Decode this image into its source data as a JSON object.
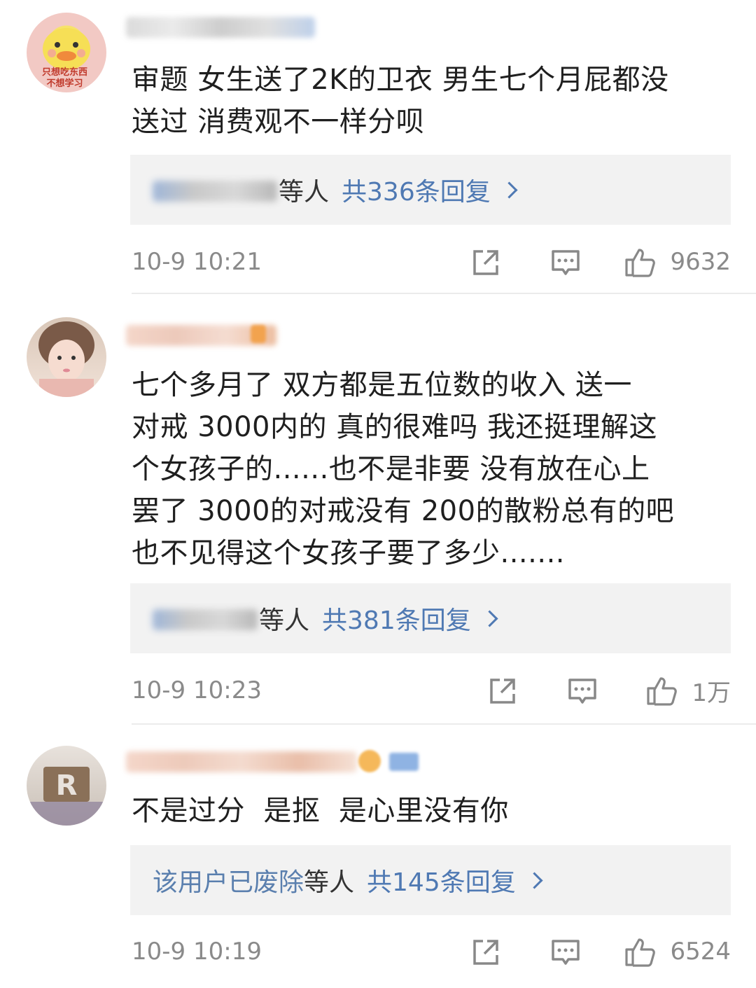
{
  "comments": [
    {
      "text": "审题 女生送了2K的卫衣 男生七个月屁都没\n送过 消费观不一样分呗",
      "avatar_badge_line1": "只想吃东西",
      "avatar_badge_line2": "不想学习",
      "reply_name_visible": "",
      "reply_suffix": "等人",
      "reply_count": "共336条回复",
      "timestamp": "10-9 10:21",
      "likes": "9632"
    },
    {
      "text": "七个多月了 双方都是五位数的收入 送一\n对戒 3000内的 真的很难吗 我还挺理解这\n个女孩子的......也不是非要 没有放在心上\n罢了 3000的对戒没有 200的散粉总有的吧\n也不见得这个女孩子要了多少.......",
      "reply_name_visible": "",
      "reply_suffix": "等人",
      "reply_count": "共381条回复",
      "timestamp": "10-9 10:23",
      "likes": "1万"
    },
    {
      "text": "不是过分  是抠  是心里没有你",
      "avatar_logo": "R",
      "reply_name_visible": "该用户已废除",
      "reply_suffix": "等人",
      "reply_count": "共145条回复",
      "timestamp": "10-9 10:19",
      "likes": "6524"
    }
  ],
  "icons": {
    "share": "share-icon",
    "comment": "comment-icon",
    "like": "thumbs-up-icon"
  },
  "colors": {
    "reply_link": "#4f79b3",
    "reply_bg": "#f2f2f2",
    "meta_gray": "#8a8a8a"
  }
}
